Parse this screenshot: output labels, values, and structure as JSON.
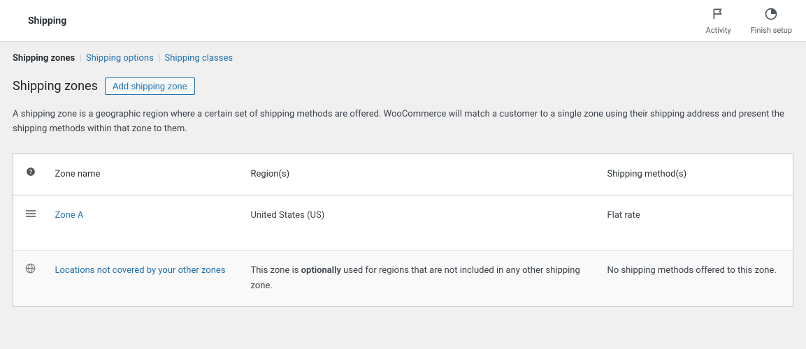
{
  "topbar": {
    "title": "Shipping",
    "actions": {
      "activity": "Activity",
      "finish_setup": "Finish setup"
    }
  },
  "subtabs": {
    "zones": "Shipping zones",
    "options": "Shipping options",
    "classes": "Shipping classes"
  },
  "section": {
    "title": "Shipping zones",
    "add_button": "Add shipping zone",
    "description": "A shipping zone is a geographic region where a certain set of shipping methods are offered. WooCommerce will match a customer to a single zone using their shipping address and present the shipping methods within that zone to them."
  },
  "table": {
    "headers": {
      "name": "Zone name",
      "regions": "Region(s)",
      "methods": "Shipping method(s)"
    },
    "rows": [
      {
        "name": "Zone A",
        "regions": "United States (US)",
        "methods": "Flat rate"
      }
    ],
    "uncovered": {
      "name": "Locations not covered by your other zones",
      "regions_prefix": "This zone is ",
      "regions_strong": "optionally",
      "regions_suffix": " used for regions that are not included in any other shipping zone.",
      "methods": "No shipping methods offered to this zone."
    }
  }
}
